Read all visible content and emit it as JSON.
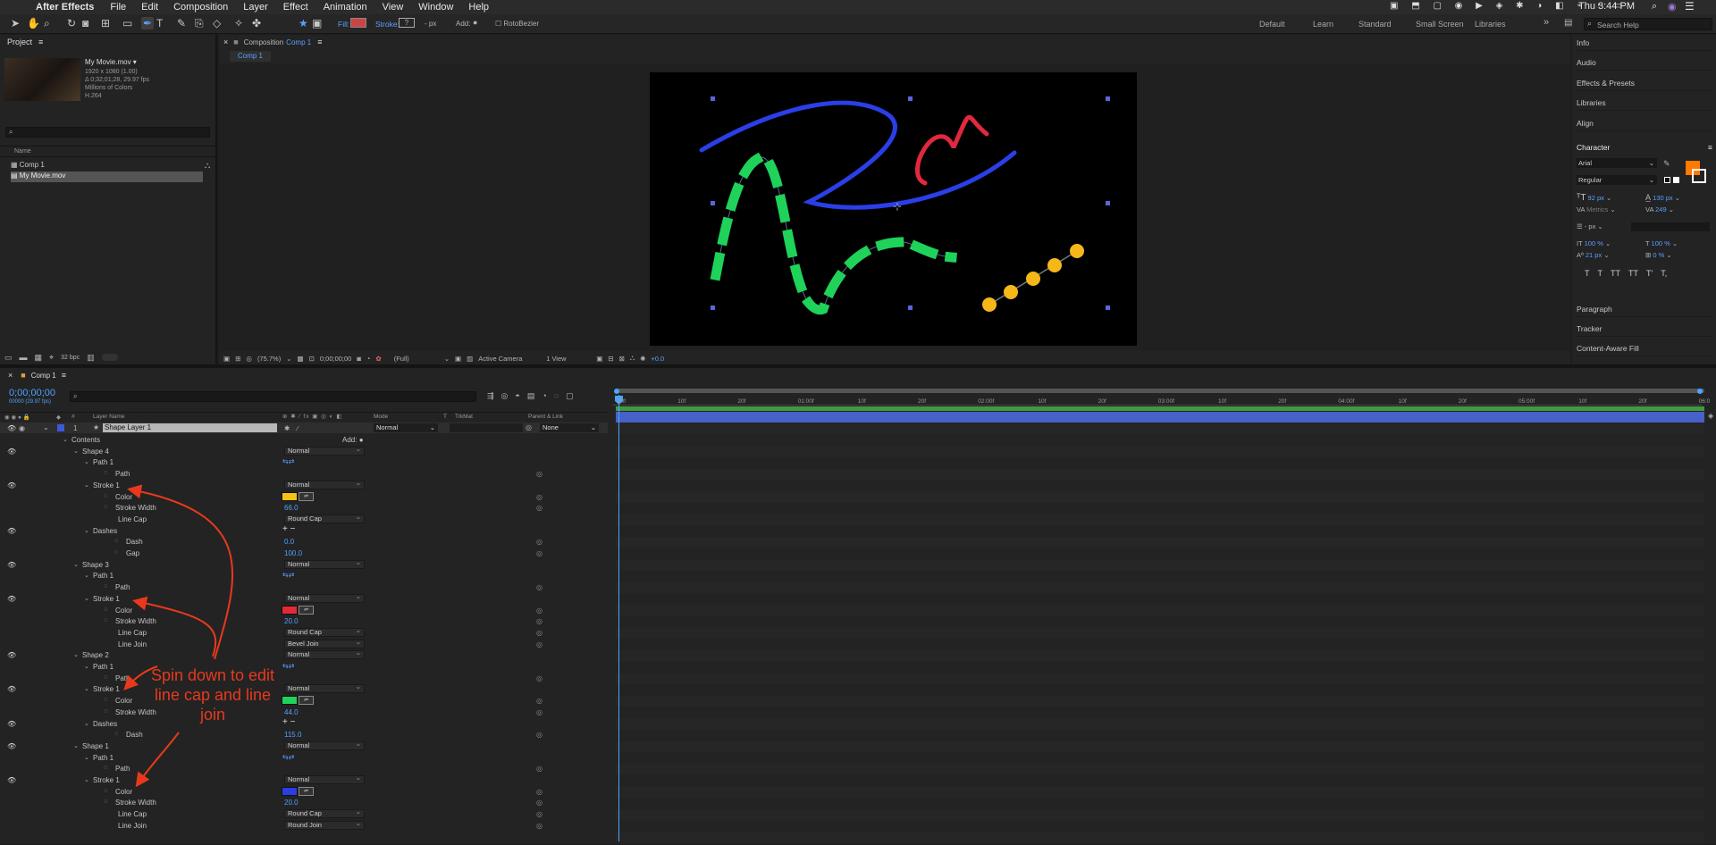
{
  "menubar": {
    "apple": "",
    "app": "After Effects",
    "items": [
      "File",
      "Edit",
      "Composition",
      "Layer",
      "Effect",
      "Animation",
      "View",
      "Window",
      "Help"
    ],
    "clock": "Thu 3:44 PM"
  },
  "toolbar": {
    "fill": "Fill:",
    "stroke": "Stroke:",
    "stroke_px": "- px",
    "add": "Add:",
    "rotobezier": "RotoBezier",
    "workspaces": [
      "Default",
      "Learn",
      "Standard",
      "Small Screen",
      "Libraries"
    ],
    "search_placeholder": "Search Help"
  },
  "project": {
    "title": "Project",
    "file": "My Movie.mov ▾",
    "info": [
      "1920 x 1080 (1.00)",
      "Δ 0;32;01;28, 29.97 fps",
      "Millions of Colors",
      "H.264"
    ],
    "col_name": "Name",
    "items": [
      "Comp 1",
      "My Movie.mov"
    ],
    "bpc": "32 bpc"
  },
  "composition": {
    "tab_prefix": "Composition",
    "tab_name": "Comp 1",
    "subtab": "Comp 1",
    "zoom": "(75.7%)",
    "timecode": "0;00;00;00",
    "res": "(Full)",
    "camera": "Active Camera",
    "view": "1 View",
    "exposure": "+0.0"
  },
  "right_panels": {
    "items": [
      "Info",
      "Audio",
      "Effects & Presets",
      "Libraries",
      "Align"
    ],
    "character": "Character",
    "font": "Arial",
    "style": "Regular",
    "size": "92 px",
    "leading": "130 px",
    "kerning": "Metrics",
    "tracking": "249",
    "stroke_w": "- px",
    "vscale": "100 %",
    "hscale": "100 %",
    "baseline": "21 px",
    "tsume": "0 %",
    "styles": [
      "T",
      "T",
      "TT",
      "TT",
      "T'",
      "T,"
    ],
    "bottom": [
      "Paragraph",
      "Tracker",
      "Content-Aware Fill"
    ],
    "fill_color": "#ff7a00"
  },
  "timeline": {
    "tab": "Comp 1",
    "timecode": "0;00;00;00",
    "fps": "00000 (29.97 fps)",
    "headers": {
      "layer_name": "Layer Name",
      "mode": "Mode",
      "t": "T",
      "trkmat": "TrkMat",
      "parent": "Parent & Link"
    },
    "layer": {
      "num": "1",
      "name": "Shape Layer 1",
      "mode": "Normal",
      "parent": "None"
    },
    "ruler": [
      "00f",
      "10f",
      "20f",
      "01:00f",
      "10f",
      "20f",
      "02:00f",
      "10f",
      "20f",
      "03:00f",
      "10f",
      "20f",
      "04:00f",
      "10f",
      "20f",
      "05:00f",
      "10f",
      "20f",
      "06:0"
    ],
    "rows": [
      {
        "ind": 0,
        "label": "Contents",
        "add": "Add:"
      },
      {
        "ind": 1,
        "label": "Shape 4",
        "sel": "Normal",
        "eye": 1
      },
      {
        "ind": 2,
        "label": "Path 1",
        "icon": 1
      },
      {
        "ind": 3,
        "label": "Path",
        "sw": 1,
        "stop": 1
      },
      {
        "ind": 2,
        "label": "Stroke 1",
        "sel": "Normal",
        "eye": 1
      },
      {
        "ind": 3,
        "label": "Color",
        "swatch": "#f5c318",
        "sw": 1,
        "stop": 1
      },
      {
        "ind": 3,
        "label": "Stroke Width",
        "val": "66.0",
        "sw": 1,
        "stop": 1
      },
      {
        "ind": 3,
        "label": "Line Cap",
        "sel": "Round Cap",
        "nostop": 1
      },
      {
        "ind": 2,
        "label": "Dashes",
        "plus": 1,
        "eye": 1
      },
      {
        "ind": 4,
        "label": "Dash",
        "val": "0.0",
        "sw": 1,
        "stop": 1
      },
      {
        "ind": 4,
        "label": "Gap",
        "val": "100.0",
        "sw": 1,
        "stop": 1
      },
      {
        "ind": 1,
        "label": "Shape 3",
        "sel": "Normal",
        "eye": 1
      },
      {
        "ind": 2,
        "label": "Path 1",
        "icon": 1
      },
      {
        "ind": 3,
        "label": "Path",
        "sw": 1,
        "stop": 1
      },
      {
        "ind": 2,
        "label": "Stroke 1",
        "sel": "Normal",
        "eye": 1
      },
      {
        "ind": 3,
        "label": "Color",
        "swatch": "#e02a38",
        "sw": 1,
        "stop": 1
      },
      {
        "ind": 3,
        "label": "Stroke Width",
        "val": "20.0",
        "sw": 1,
        "stop": 1
      },
      {
        "ind": 3,
        "label": "Line Cap",
        "sel": "Round Cap",
        "nostop": 1,
        "sw": 1
      },
      {
        "ind": 3,
        "label": "Line Join",
        "sel": "Bevel Join",
        "nostop": 1,
        "sw": 1
      },
      {
        "ind": 1,
        "label": "Shape 2",
        "sel": "Normal",
        "eye": 1
      },
      {
        "ind": 2,
        "label": "Path 1",
        "icon": 1
      },
      {
        "ind": 3,
        "label": "Path",
        "sw": 1,
        "stop": 1
      },
      {
        "ind": 2,
        "label": "Stroke 1",
        "sel": "Normal",
        "eye": 1
      },
      {
        "ind": 3,
        "label": "Color",
        "swatch": "#1fd25a",
        "sw": 1,
        "stop": 1
      },
      {
        "ind": 3,
        "label": "Stroke Width",
        "val": "44.0",
        "sw": 1,
        "stop": 1
      },
      {
        "ind": 2,
        "label": "Dashes",
        "plus": 1,
        "eye": 1
      },
      {
        "ind": 4,
        "label": "Dash",
        "val": "115.0",
        "sw": 1,
        "stop": 1
      },
      {
        "ind": 1,
        "label": "Shape 1",
        "sel": "Normal",
        "eye": 1
      },
      {
        "ind": 2,
        "label": "Path 1",
        "icon": 1
      },
      {
        "ind": 3,
        "label": "Path",
        "sw": 1,
        "stop": 1
      },
      {
        "ind": 2,
        "label": "Stroke 1",
        "sel": "Normal",
        "eye": 1
      },
      {
        "ind": 3,
        "label": "Color",
        "swatch": "#2a3fe0",
        "sw": 1,
        "stop": 1
      },
      {
        "ind": 3,
        "label": "Stroke Width",
        "val": "20.0",
        "sw": 1,
        "stop": 1
      },
      {
        "ind": 3,
        "label": "Line Cap",
        "sel": "Round Cap",
        "nostop": 1,
        "sw": 1
      },
      {
        "ind": 3,
        "label": "Line Join",
        "sel": "Round Join",
        "nostop": 1,
        "sw": 1
      }
    ]
  },
  "annotation": {
    "text": "Spin down to edit line cap and line join",
    "color": "#e8391d"
  }
}
